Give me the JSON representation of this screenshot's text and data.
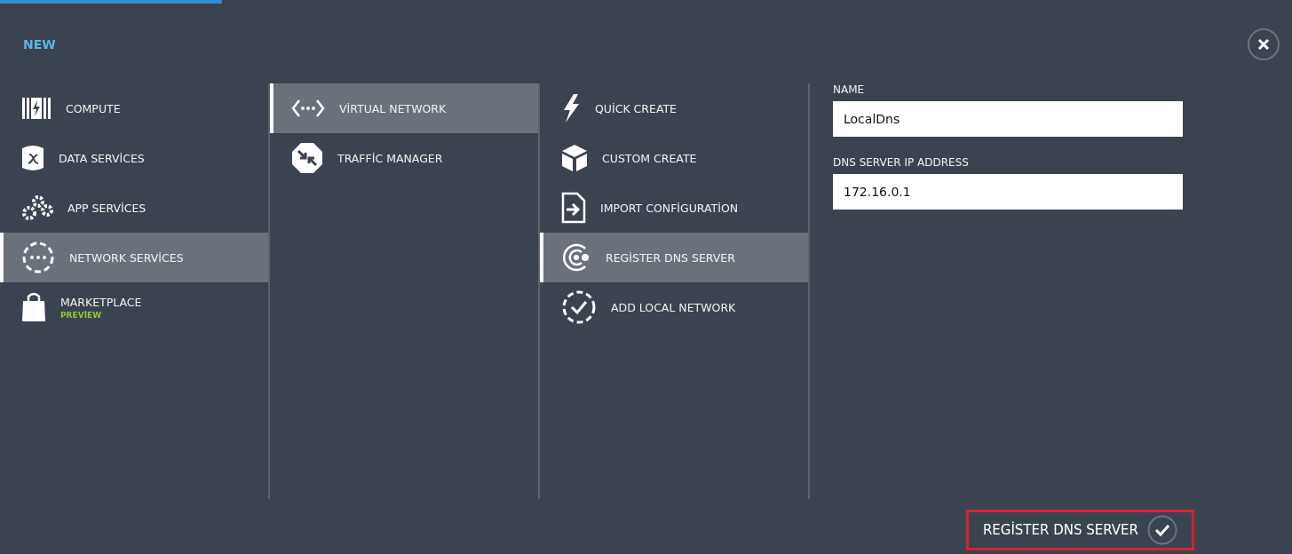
{
  "dialog": {
    "title": "NEW"
  },
  "categories": [
    {
      "label": "COMPUTE",
      "selected": false
    },
    {
      "label": "DATA SERVİCES",
      "selected": false
    },
    {
      "label": "APP SERVİCES",
      "selected": false
    },
    {
      "label": "NETWORK SERVİCES",
      "selected": true
    },
    {
      "label": "MARKETPLACE",
      "badge": "PREVİEW",
      "selected": false
    }
  ],
  "services": [
    {
      "label": "VİRTUAL NETWORK",
      "selected": true
    },
    {
      "label": "TRAFFİC MANAGER",
      "selected": false
    }
  ],
  "actions": [
    {
      "label": "QUİCK CREATE",
      "selected": false
    },
    {
      "label": "CUSTOM CREATE",
      "selected": false
    },
    {
      "label": "IMPORT CONFİGURATİON",
      "selected": false
    },
    {
      "label": "REGİSTER DNS SERVER",
      "selected": true
    },
    {
      "label": "ADD LOCAL NETWORK",
      "selected": false
    }
  ],
  "form": {
    "fields": [
      {
        "label": "NAME",
        "value": "LocalDns"
      },
      {
        "label": "DNS SERVER IP ADDRESS",
        "value": "172.16.0.1"
      }
    ]
  },
  "submit": {
    "label": "REGİSTER DNS SERVER",
    "highlighted": true
  }
}
